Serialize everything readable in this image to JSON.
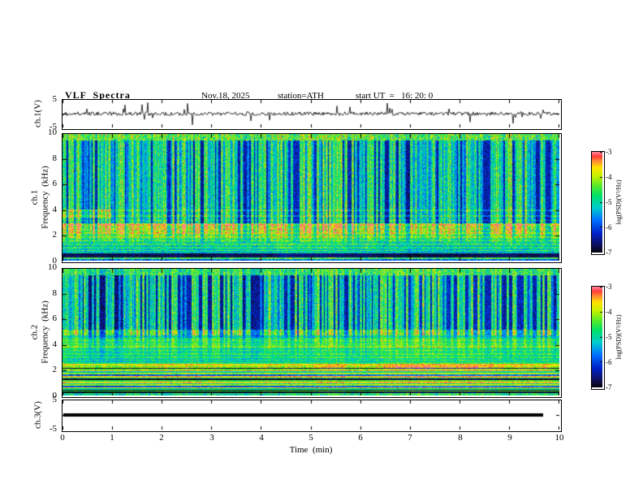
{
  "header": {
    "title": "VLF  Spectra",
    "date": "Nov.18, 2025",
    "station": "station=ATH",
    "start_ut": "start UT  =   16: 20: 0"
  },
  "xaxis": {
    "label": "Time  (min)",
    "min": 0,
    "max": 10,
    "ticks": [
      "0",
      "1",
      "2",
      "3",
      "4",
      "5",
      "6",
      "7",
      "8",
      "9",
      "10"
    ]
  },
  "panels": {
    "waveform": {
      "ylabel": "ch.1(V)",
      "ytop": "5",
      "ybottom": "-5"
    },
    "spec1": {
      "ylabel_line1": "ch.1",
      "ylabel_line2": "Frequency  (kHz)",
      "yticks": [
        "0",
        "2",
        "4",
        "6",
        "8",
        "10"
      ]
    },
    "spec2": {
      "ylabel_line1": "ch.2",
      "ylabel_line2": "Frequency  (kHz)",
      "yticks": [
        "0",
        "2",
        "4",
        "6",
        "8",
        "10"
      ]
    },
    "ch3": {
      "ylabel": "ch.3(V)",
      "ytop": "5",
      "ybottom": "-5"
    }
  },
  "colorbar": {
    "label": "log(PSD)(V²/Hz)",
    "ticks": [
      "-3",
      "-4",
      "-5",
      "-6",
      "-7"
    ],
    "max": -3,
    "min": -7
  },
  "colors": {
    "axis": "#000000",
    "background": "#ffffff"
  },
  "chart_data": [
    {
      "type": "line",
      "name": "ch.1 voltage time series",
      "ylabel": "ch.1(V)",
      "ylim": [
        -5,
        5
      ],
      "xlim": [
        0,
        10
      ],
      "xlabel": "Time (min)",
      "description": "Broadband VLF receiver voltage: continuous noise of about ±1 V around 0 with frequent impulsive sferic spikes reaching about ±4 V across the full 10-minute record."
    },
    {
      "type": "heatmap",
      "name": "ch.1 spectrogram",
      "ylabel": "Frequency (kHz)",
      "ylim": [
        0,
        10
      ],
      "xlim": [
        0,
        10
      ],
      "zlabel": "log(PSD)(V²/Hz)",
      "zlim": [
        -7,
        -3
      ],
      "description": "Dense vertical sferic streaks (green/yellow, PSD near 1e-4) over a dark blue background (near 1e-6.5) above ~3 kHz; cyan-green banded hum structure with thin horizontal lines below 3 kHz; dark horizontal band near 0.3-0.55 kHz; yellow-green band along the 9.5-10 kHz top edge; cyan patch near 3.7 kHz at the start."
    },
    {
      "type": "heatmap",
      "name": "ch.2 spectrogram",
      "ylabel": "Frequency (kHz)",
      "ylim": [
        0,
        10
      ],
      "xlim": [
        0,
        10
      ],
      "zlabel": "log(PSD)(V²/Hz)",
      "zlim": [
        -7,
        -3
      ],
      "description": "Vertical sferic streaks over dark blue above ~5 kHz; green background from 2.5-4.6 kHz with thin horizontal lines; strong blotchy yellow-orange band near 2-2.4 kHz; alternating bright green / yellow / red / black horizontal power-line harmonic stripes below 2 kHz."
    },
    {
      "type": "line",
      "name": "ch.3 voltage time series",
      "ylabel": "ch.3(V)",
      "ylim": [
        -5,
        5
      ],
      "xlim": [
        0,
        10
      ],
      "value": 0,
      "description": "Flat thick black line at 0 V extending from 0 to about 9.7 min (channel inactive)."
    }
  ]
}
